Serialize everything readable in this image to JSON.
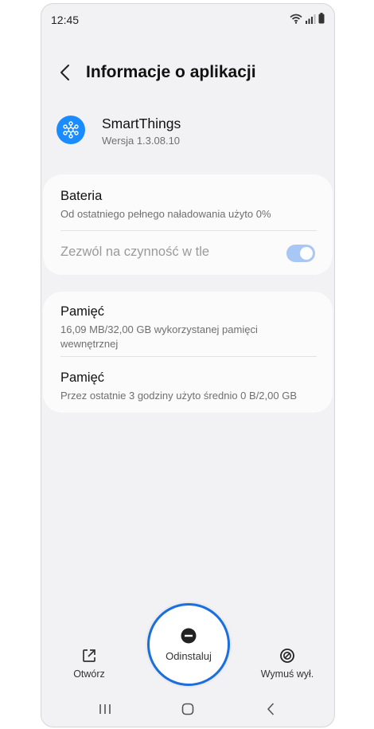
{
  "status_bar": {
    "time": "12:45"
  },
  "header": {
    "title": "Informacje o aplikacji"
  },
  "app": {
    "name": "SmartThings",
    "version": "Wersja 1.3.08.10",
    "icon_color": "#1a8cff"
  },
  "battery": {
    "title": "Bateria",
    "subtitle": "Od ostatniego pełnego naładowania użyto 0%"
  },
  "background_activity": {
    "label": "Zezwól na czynność w tle",
    "enabled": true
  },
  "storage": {
    "title": "Pamięć",
    "subtitle": "16,09 MB/32,00 GB wykorzystanej pamięci wewnętrznej"
  },
  "memory": {
    "title": "Pamięć",
    "subtitle": "Przez ostatnie 3 godziny użyto średnio 0 B/2,00 GB"
  },
  "actions": {
    "open": "Otwórz",
    "uninstall": "Odinstaluj",
    "force_stop": "Wymuś wył."
  },
  "colors": {
    "accent": "#1a6fde",
    "toggle": "#a9c7f5",
    "background": "#f2f2f4"
  },
  "icons": [
    "back-icon",
    "smartthings-icon",
    "open-icon",
    "uninstall-icon",
    "force-stop-icon",
    "recent-apps-icon",
    "home-icon",
    "nav-back-icon",
    "wifi-icon",
    "signal-icon",
    "battery-icon"
  ]
}
